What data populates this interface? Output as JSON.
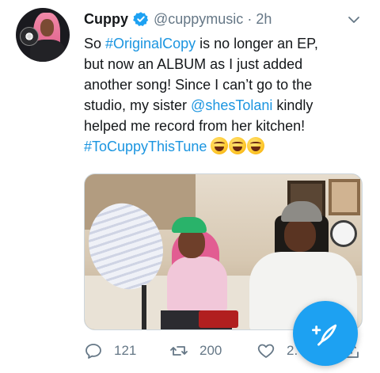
{
  "tweet": {
    "author_name": "Cuppy",
    "handle": "@cuppymusic",
    "separator": "·",
    "time": "2h",
    "text_lines": [
      [
        "So ",
        "#OriginalCopy",
        " is no longer an EP,"
      ],
      [
        "but now an ALBUM as I just added"
      ],
      [
        "another song! Since I can’t go to the"
      ],
      [
        "studio, my sister ",
        "@shesTolani",
        " kindly"
      ],
      [
        "helped me record from her kitchen!"
      ],
      [
        "#ToCuppyThisTune"
      ]
    ],
    "hashtag_1": "#OriginalCopy",
    "mention": "@shesTolani",
    "hashtag_2": "#ToCuppyThisTune",
    "emojis": [
      "joy-emoji",
      "grin-sweat-emoji",
      "rofl-emoji"
    ],
    "photo_alt": "Two women recording music in a kitchen"
  },
  "actions": {
    "reply_count": "121",
    "retweet_count": "200",
    "like_count": "2."
  },
  "icons": {
    "verified": "verified-badge-icon",
    "more": "chevron-down-icon",
    "reply": "reply-icon",
    "retweet": "retweet-icon",
    "like": "heart-icon",
    "share": "share-icon",
    "compose": "compose-feather-icon"
  },
  "colors": {
    "link": "#1b95e0",
    "accent": "#1da1f2",
    "muted": "#657786",
    "text": "#14171a"
  }
}
